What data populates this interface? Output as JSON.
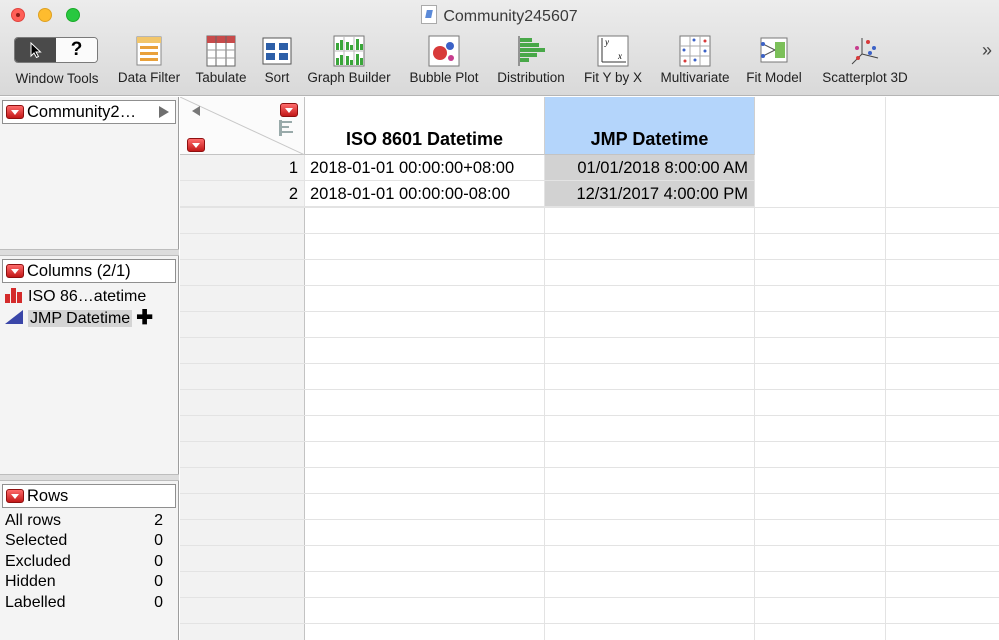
{
  "window": {
    "title": "Community245607"
  },
  "toolbar": {
    "items": [
      {
        "label": "Window Tools",
        "icon": "window-tools-icon"
      },
      {
        "label": "Data Filter",
        "icon": "data-filter-icon"
      },
      {
        "label": "Tabulate",
        "icon": "tabulate-icon"
      },
      {
        "label": "Sort",
        "icon": "sort-icon"
      },
      {
        "label": "Graph Builder",
        "icon": "graph-builder-icon"
      },
      {
        "label": "Bubble Plot",
        "icon": "bubble-plot-icon"
      },
      {
        "label": "Distribution",
        "icon": "distribution-icon"
      },
      {
        "label": "Fit Y by X",
        "icon": "fit-y-by-x-icon"
      },
      {
        "label": "Multivariate",
        "icon": "multivariate-icon"
      },
      {
        "label": "Fit Model",
        "icon": "fit-model-icon"
      },
      {
        "label": "Scatterplot 3D",
        "icon": "scatterplot-3d-icon"
      }
    ],
    "window_tools_help": "?",
    "overflow": "»"
  },
  "table_panel": {
    "title": "Community2…"
  },
  "columns_panel": {
    "title": "Columns (2/1)",
    "items": [
      {
        "label": "ISO 86…atetime",
        "type": "nominal"
      },
      {
        "label": "JMP Datetime",
        "type": "continuous"
      }
    ]
  },
  "rows_panel": {
    "title": "Rows",
    "stats": [
      {
        "label": "All rows",
        "value": "2"
      },
      {
        "label": "Selected",
        "value": "0"
      },
      {
        "label": "Excluded",
        "value": "0"
      },
      {
        "label": "Hidden",
        "value": "0"
      },
      {
        "label": "Labelled",
        "value": "0"
      }
    ]
  },
  "grid": {
    "columns": [
      "ISO 8601 Datetime",
      "JMP Datetime"
    ],
    "rows": [
      {
        "num": "1",
        "cells": [
          "2018-01-01 00:00:00+08:00",
          "01/01/2018 8:00:00 AM"
        ]
      },
      {
        "num": "2",
        "cells": [
          "2018-01-01 00:00:00-08:00",
          "12/31/2017 4:00:00 PM"
        ]
      }
    ]
  },
  "colors": {
    "selected_header": "#b4d5fb",
    "selected_cell": "#d2d2d2",
    "red_triangle": "#d42b2b"
  }
}
